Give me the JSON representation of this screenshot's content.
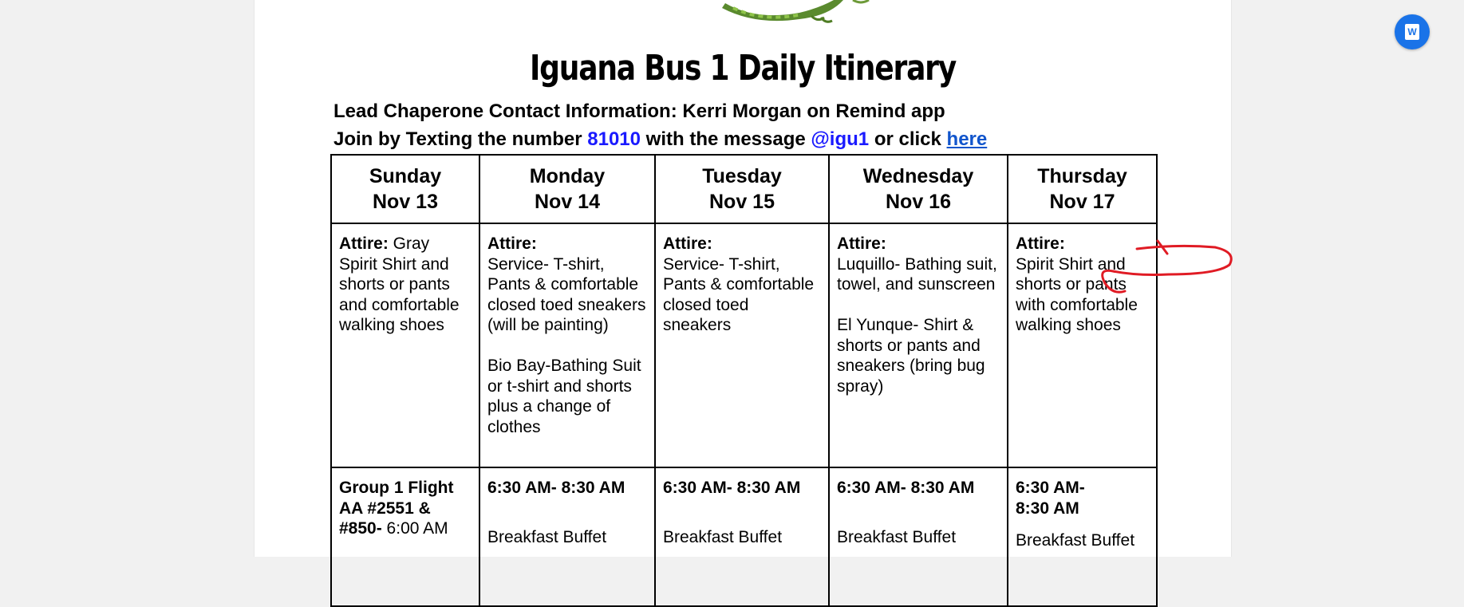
{
  "document": {
    "title": "Iguana Bus 1 Daily Itinerary",
    "contact_line": "Lead Chaperone Contact Information: Kerri Morgan on Remind app",
    "join": {
      "prefix": "Join by Texting the number ",
      "number": "81010",
      "middle": " with the message ",
      "message": "@igu1",
      "suffix": " or click ",
      "link_text": "here"
    },
    "days": [
      {
        "day": "Sunday",
        "date": "Nov 13"
      },
      {
        "day": "Monday",
        "date": "Nov 14"
      },
      {
        "day": "Tuesday",
        "date": "Nov 15"
      },
      {
        "day": "Wednesday",
        "date": "Nov 16"
      },
      {
        "day": "Thursday",
        "date": "Nov 17"
      }
    ],
    "attire_label": "Attire:",
    "attire": [
      " Gray Spirit Shirt and shorts or pants and comfortable walking shoes",
      "Service- T-shirt, Pants & comfortable closed toed sneakers (will be painting)\n\nBio Bay-Bathing Suit or t-shirt and shorts plus a change of clothes",
      "Service- T-shirt, Pants & comfortable closed toed sneakers",
      "Luquillo- Bathing suit, towel, and sunscreen\n\nEl Yunque- Shirt & shorts or pants and sneakers (bring bug spray)",
      "Spirit Shirt and shorts or pants with comfortable walking shoes"
    ],
    "schedule": {
      "sunday_bold": "Group 1 Flight AA #2551 & #850-",
      "sunday_time": " 6:00 AM",
      "monday_time": "6:30 AM- 8:30 AM",
      "monday_item": "Breakfast Buffet",
      "tuesday_time": "6:30 AM- 8:30 AM",
      "tuesday_item": "Breakfast Buffet",
      "wednesday_time": "6:30 AM- 8:30 AM",
      "wednesday_item": "Breakfast Buffet",
      "thursday_time": "6:30 AM-\n8:30 AM",
      "thursday_item": "Breakfast Buffet"
    }
  },
  "ui": {
    "word_button_icon": "word-icon",
    "word_button_letter": "W",
    "annotation_color": "#e01b24"
  }
}
